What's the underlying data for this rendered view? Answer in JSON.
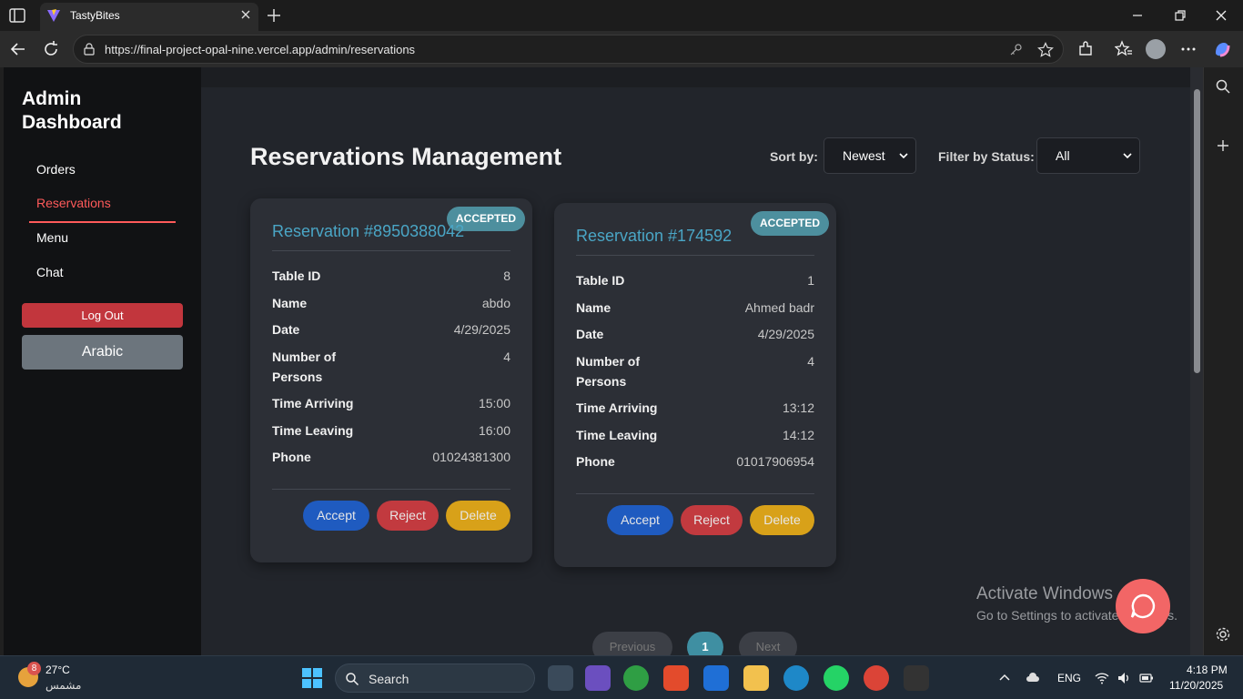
{
  "browser": {
    "tab_title": "TastyBites",
    "url": "https://final-project-opal-nine.vercel.app/admin/reservations"
  },
  "sidebar": {
    "brand": "Admin Dashboard",
    "items": [
      {
        "label": "Orders",
        "active": false
      },
      {
        "label": "Reservations",
        "active": true
      },
      {
        "label": "Menu",
        "active": false
      },
      {
        "label": "Chat",
        "active": false
      }
    ],
    "logout_label": "Log Out",
    "language_label": "Arabic"
  },
  "main": {
    "title": "Reservations Management",
    "sort_label": "Sort by:",
    "sort_value": "Newest",
    "filter_label": "Filter by Status:",
    "filter_value": "All"
  },
  "field_labels": {
    "table_id": "Table ID",
    "name": "Name",
    "date": "Date",
    "persons": "Number of Persons",
    "time_arriving": "Time Arriving",
    "time_leaving": "Time Leaving",
    "phone": "Phone"
  },
  "actions": {
    "accept": "Accept",
    "reject": "Reject",
    "delete": "Delete"
  },
  "reservations": [
    {
      "title": "Reservation #8950388042",
      "status": "ACCEPTED",
      "table_id": "8",
      "name": "abdo",
      "date": "4/29/2025",
      "persons": "4",
      "time_arriving": "15:00",
      "time_leaving": "16:00",
      "phone": "01024381300"
    },
    {
      "title": "Reservation #174592",
      "status": "ACCEPTED",
      "table_id": "1",
      "name": "Ahmed badr",
      "date": "4/29/2025",
      "persons": "4",
      "time_arriving": "13:12",
      "time_leaving": "14:12",
      "phone": "01017906954"
    }
  ],
  "pagination": {
    "prev": "Previous",
    "current": "1",
    "next": "Next"
  },
  "watermark": {
    "line1": "Activate Windows",
    "line2": "Go to Settings to activate Windows."
  },
  "taskbar": {
    "temperature": "27°C",
    "condition": "مشمس",
    "weather_badge": "8",
    "search_placeholder": "Search",
    "language": "ENG",
    "time": "4:18 PM",
    "date": "11/20/2025"
  },
  "colors": {
    "accent_red": "#ff5a5a",
    "card_title": "#4aa6c6",
    "badge": "#4d8f9e",
    "accept": "#1f5bc0",
    "reject": "#c23a3f",
    "delete": "#d8a119"
  }
}
